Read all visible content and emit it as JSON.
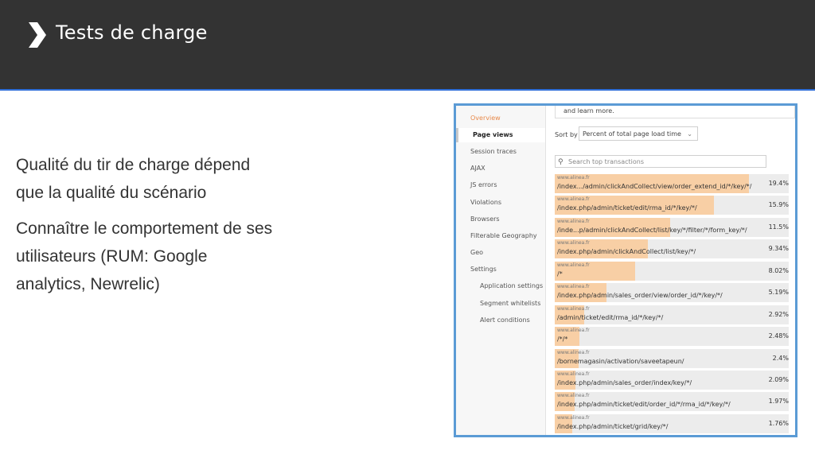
{
  "slide": {
    "title": "Tests de charge",
    "accent_color": "#2f6fd8",
    "header_color": "#333333",
    "bullets": [
      "Qualité du tir de charge dépend que la qualité du scénario",
      "Connaître le comportement de ses utilisateurs (RUM: Google analytics, Newrelic)"
    ]
  },
  "screenshot": {
    "nav": [
      "Overview",
      "Page views",
      "Session traces",
      "AJAX",
      "JS errors",
      "Violations",
      "Browsers",
      "Filterable Geography",
      "Geo",
      "Settings"
    ],
    "nav_sub": [
      "Application settings",
      "Segment whitelists",
      "Alert conditions"
    ],
    "banner": "and learn more.",
    "sort_label": "Sort by",
    "sort_value": "Percent of total page load time",
    "search_placeholder": "Search top transactions",
    "rows": [
      {
        "host": "www.alinea.fr",
        "path": "/index.../admin/clickAndCollect/view/order_extend_id/*/key/*/",
        "pct": "19.4%",
        "value": 19.4
      },
      {
        "host": "www.alinea.fr",
        "path": "/index.php/admin/ticket/edit/rma_id/*/key/*/",
        "pct": "15.9%",
        "value": 15.9
      },
      {
        "host": "www.alinea.fr",
        "path": "/inde...p/admin/clickAndCollect/list/key/*/filter/*/form_key/*/",
        "pct": "11.5%",
        "value": 11.5
      },
      {
        "host": "www.alinea.fr",
        "path": "/index.php/admin/clickAndCollect/list/key/*/",
        "pct": "9.34%",
        "value": 9.34
      },
      {
        "host": "www.alinea.fr",
        "path": "/*",
        "pct": "8.02%",
        "value": 8.02
      },
      {
        "host": "www.alinea.fr",
        "path": "/index.php/admin/sales_order/view/order_id/*/key/*/",
        "pct": "5.19%",
        "value": 5.19
      },
      {
        "host": "www.alinea.fr",
        "path": "/admin/ticket/edit/rma_id/*/key/*/",
        "pct": "2.92%",
        "value": 2.92
      },
      {
        "host": "www.alinea.fr",
        "path": "/*/*",
        "pct": "2.48%",
        "value": 2.48
      },
      {
        "host": "www.alinea.fr",
        "path": "/bornemagasin/activation/saveetapeun/",
        "pct": "2.4%",
        "value": 2.4
      },
      {
        "host": "www.alinea.fr",
        "path": "/index.php/admin/sales_order/index/key/*/",
        "pct": "2.09%",
        "value": 2.09
      },
      {
        "host": "www.alinea.fr",
        "path": "/index.php/admin/ticket/edit/order_id/*/rma_id/*/key/*/",
        "pct": "1.97%",
        "value": 1.97
      },
      {
        "host": "www.alinea.fr",
        "path": "/index.php/admin/ticket/grid/key/*/",
        "pct": "1.76%",
        "value": 1.76
      }
    ]
  }
}
